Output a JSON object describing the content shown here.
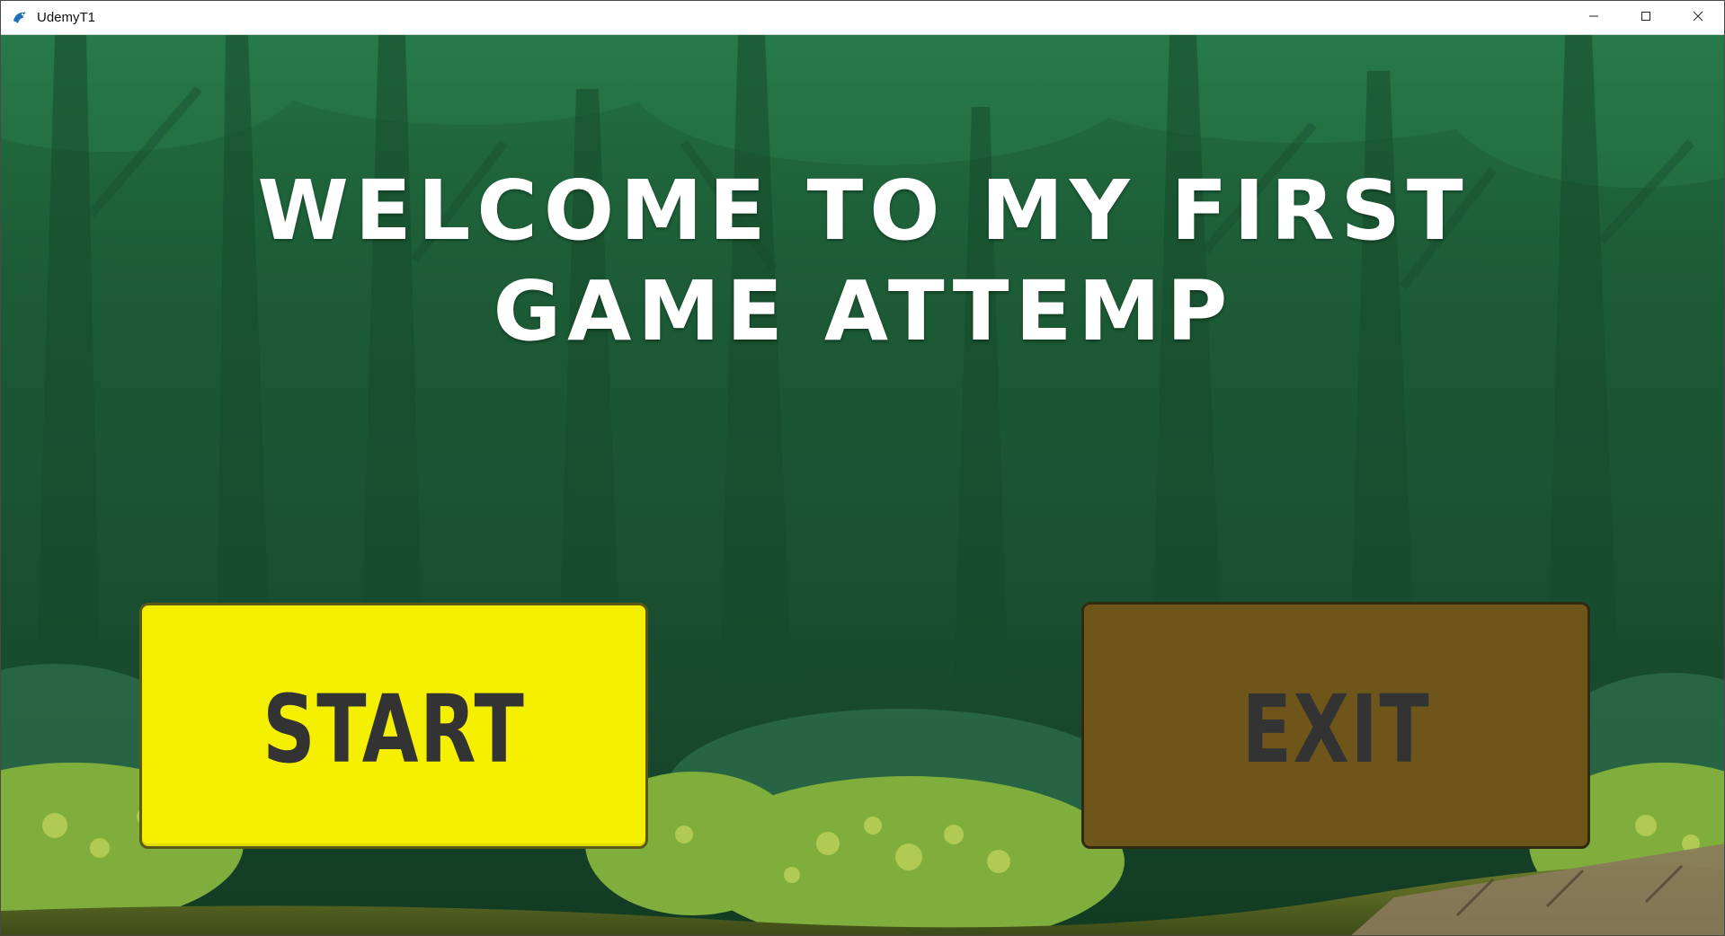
{
  "window": {
    "title": "UdemyT1",
    "icon": "app-bird-icon",
    "controls": [
      "minimize-icon",
      "maximize-icon",
      "close-icon"
    ]
  },
  "game": {
    "headline_line1": "WELCOME TO MY FIRST",
    "headline_line2": "GAME ATTEMP",
    "start_label": "START",
    "exit_label": "EXIT"
  },
  "colors": {
    "start_button": "#f5ef00",
    "exit_button": "#6e5519",
    "button_text": "#333333",
    "headline": "#ffffff"
  }
}
